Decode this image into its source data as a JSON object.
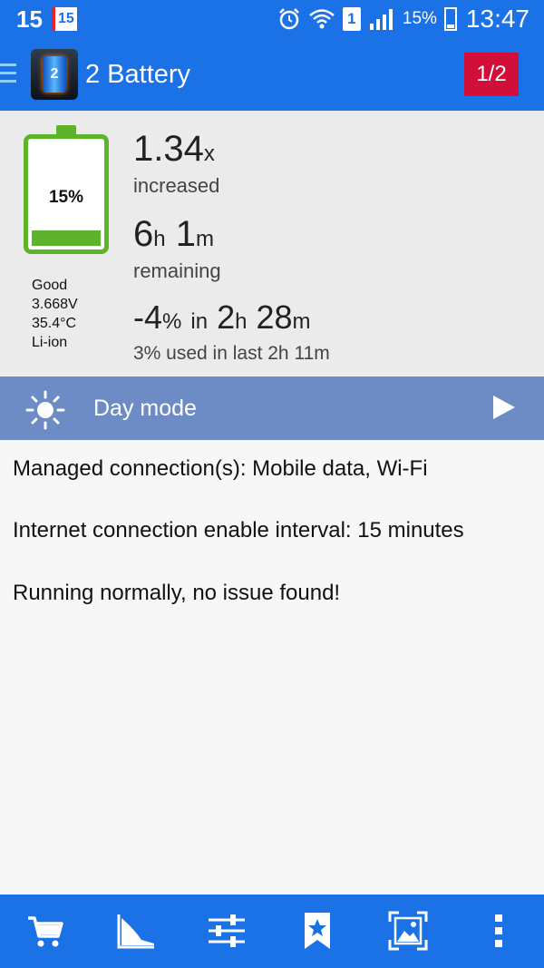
{
  "status_bar": {
    "left_number": "15",
    "calendar_badge": "15",
    "sim_slot": "1",
    "battery_percent": "15%",
    "time": "13:47",
    "icons": [
      "alarm-icon",
      "wifi-icon",
      "sim-icon",
      "signal-icon",
      "battery-icon"
    ]
  },
  "app_bar": {
    "title": "2 Battery",
    "logo_label": "2",
    "page_indicator": "1/2"
  },
  "battery": {
    "percent_label": "15%",
    "level_fraction": 0.15,
    "health": "Good",
    "voltage": "3.668V",
    "temperature": "35.4°C",
    "type": "Li-ion"
  },
  "stats": {
    "increase_value": "1.34",
    "increase_unit": "x",
    "increase_label": "increased",
    "remain_hours": "6",
    "remain_hours_unit": "h",
    "remain_minutes": "1",
    "remain_minutes_unit": "m",
    "remain_label": "remaining",
    "drain_value": "-4",
    "drain_unit": "%",
    "drain_in": "in",
    "drain_hours": "2",
    "drain_hours_unit": "h",
    "drain_minutes": "28",
    "drain_minutes_unit": "m",
    "used_label": "3% used in last 2h 11m"
  },
  "mode": {
    "label": "Day mode"
  },
  "messages": {
    "managed": "Managed connection(s): Mobile data, Wi-Fi",
    "interval": "Internet connection enable interval: 15 minutes",
    "status": "Running normally, no issue found!"
  },
  "bottom_bar": {
    "icons": [
      "cart-icon",
      "chart-icon",
      "sliders-icon",
      "bookmark-icon",
      "screenshot-icon",
      "overflow-menu-icon"
    ]
  },
  "colors": {
    "primary": "#1a72e6",
    "battery_green": "#5db32a",
    "badge_red": "#d0103a",
    "mode_bar": "#6d8cc5"
  }
}
